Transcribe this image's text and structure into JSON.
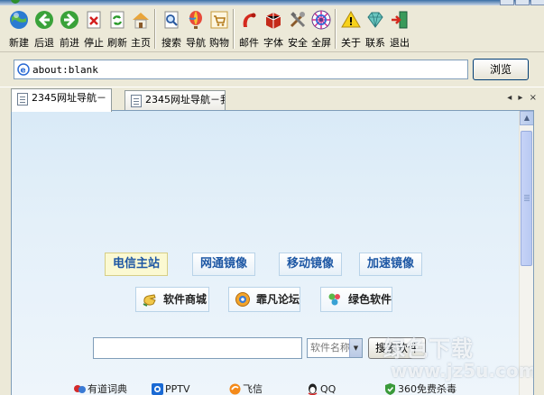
{
  "toolbar": {
    "buttons": [
      {
        "label": "新建",
        "icon": "globe-icon"
      },
      {
        "label": "后退",
        "icon": "back-arrow-icon"
      },
      {
        "label": "前进",
        "icon": "forward-arrow-icon"
      },
      {
        "label": "停止",
        "icon": "stop-icon"
      },
      {
        "label": "刷新",
        "icon": "refresh-icon"
      },
      {
        "label": "主页",
        "icon": "home-icon"
      },
      {
        "label": "搜索",
        "icon": "search-icon"
      },
      {
        "label": "导航",
        "icon": "balloon-icon"
      },
      {
        "label": "购物",
        "icon": "cart-icon"
      },
      {
        "label": "邮件",
        "icon": "mail-icon"
      },
      {
        "label": "字体",
        "icon": "font-icon"
      },
      {
        "label": "安全",
        "icon": "tools-icon"
      },
      {
        "label": "全屏",
        "icon": "fullscreen-icon"
      },
      {
        "label": "关于",
        "icon": "warning-icon"
      },
      {
        "label": "联系",
        "icon": "diamond-icon"
      },
      {
        "label": "退出",
        "icon": "exit-icon"
      }
    ]
  },
  "address": {
    "value": "about:blank",
    "go_label": "浏览"
  },
  "tabs": [
    {
      "label": "2345网址导航－"
    },
    {
      "label": "2345网址导航－我"
    }
  ],
  "tab_nav": "◂ ▸ ×",
  "page": {
    "mirrors": [
      {
        "label": "电信主站"
      },
      {
        "label": "网通镜像"
      },
      {
        "label": "移动镜像"
      },
      {
        "label": "加速镜像"
      }
    ],
    "software_links": [
      {
        "label": "软件商城"
      },
      {
        "label": "霏凡论坛"
      },
      {
        "label": "绿色软件"
      }
    ],
    "search": {
      "placeholder": "",
      "category": "软件名称",
      "button_label": "搜索软件"
    },
    "sites": [
      {
        "label": "有道词典"
      },
      {
        "label": "PPTV"
      },
      {
        "label": "飞信"
      },
      {
        "label": "QQ"
      },
      {
        "label": "360免费杀毒"
      }
    ]
  },
  "watermark": {
    "line1": "绿色下载",
    "line2": "www.jz5u.com"
  },
  "colors": {
    "chrome": "#ece9d8",
    "content_bg": "#e4f0f9",
    "mirror_text": "#1d57a4",
    "selected_mirror": "#fbf9d2"
  }
}
